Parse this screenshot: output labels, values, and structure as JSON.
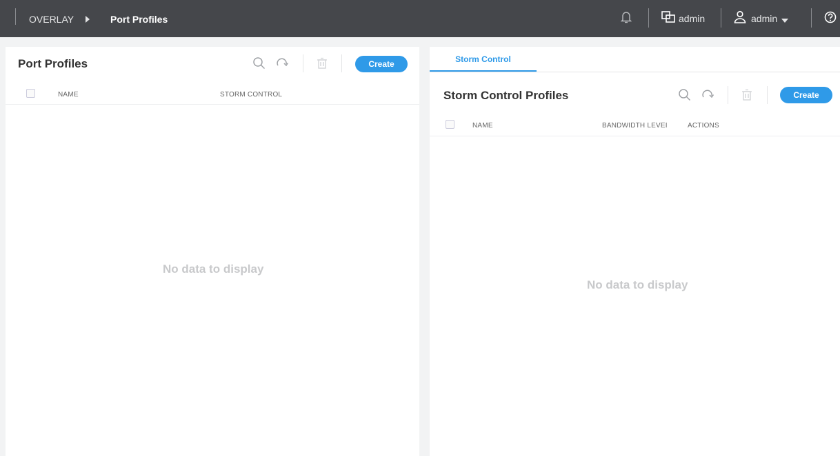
{
  "topbar": {
    "breadcrumb_root": "OVERLAY",
    "breadcrumb_current": "Port Profiles",
    "tenant_label": "admin",
    "user_label": "admin"
  },
  "left_panel": {
    "title": "Port Profiles",
    "create_label": "Create",
    "columns": [
      "NAME",
      "STORM CONTROL"
    ],
    "empty_text": "No data to display"
  },
  "right_panel": {
    "tabs": [
      {
        "label": "Storm Control",
        "active": true
      }
    ],
    "title": "Storm Control Profiles",
    "create_label": "Create",
    "columns": [
      "NAME",
      "BANDWIDTH LEVEI",
      "ACTIONS"
    ],
    "empty_text": "No data to display"
  },
  "icons": {
    "search": "search-icon",
    "refresh": "refresh-icon",
    "delete": "trash-icon",
    "notifications": "bell-icon",
    "tenant": "tenant-switch-icon",
    "user": "user-icon",
    "help": "help-icon"
  },
  "colors": {
    "topbar_bg": "#45474b",
    "accent": "#2f9ae8",
    "empty_text": "#c8c9cb"
  }
}
